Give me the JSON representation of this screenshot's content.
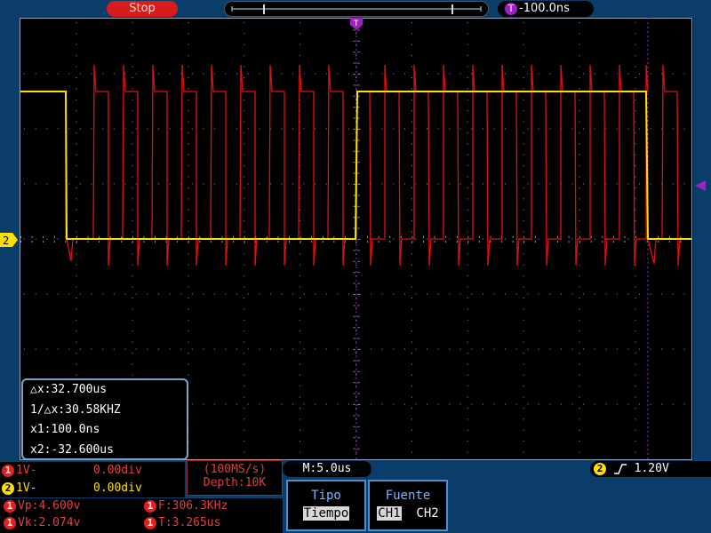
{
  "top": {
    "run_status": "Stop",
    "trigger_position": "-100.0ns"
  },
  "markers": {
    "ch2_marker": "2",
    "trig_marker": "T"
  },
  "cursors": {
    "dx": "△x:32.700us",
    "inv_dx": "1/△x:30.58KHZ",
    "x1": "x1:100.0ns",
    "x2": "x2:-32.600us"
  },
  "channels": {
    "ch1": {
      "num": "1",
      "scale": "1V-",
      "offset": "0.00div"
    },
    "ch2": {
      "num": "2",
      "scale": "1V-",
      "offset": "0.00div"
    }
  },
  "acquisition": {
    "sample_rate": "(100MS/s)",
    "depth": "Depth:10K"
  },
  "timebase": "M:5.0us",
  "trigger": {
    "source": "2",
    "level": "1.20V"
  },
  "measurements": {
    "vp": "Vp:4.600v",
    "vk": "Vk:2.074v",
    "freq": "F:306.3KHz",
    "period": "T:3.265us"
  },
  "menu": {
    "tipo_title": "Tipo",
    "tipo_value": "Tiempo",
    "fuente_title": "Fuente",
    "fuente_opt1": "CH1",
    "fuente_opt2": "CH2"
  },
  "colors": {
    "ch1": "#e01010",
    "ch2": "#ffe000",
    "cursor": "#a020c8",
    "grid": "#8aa0b0"
  }
}
